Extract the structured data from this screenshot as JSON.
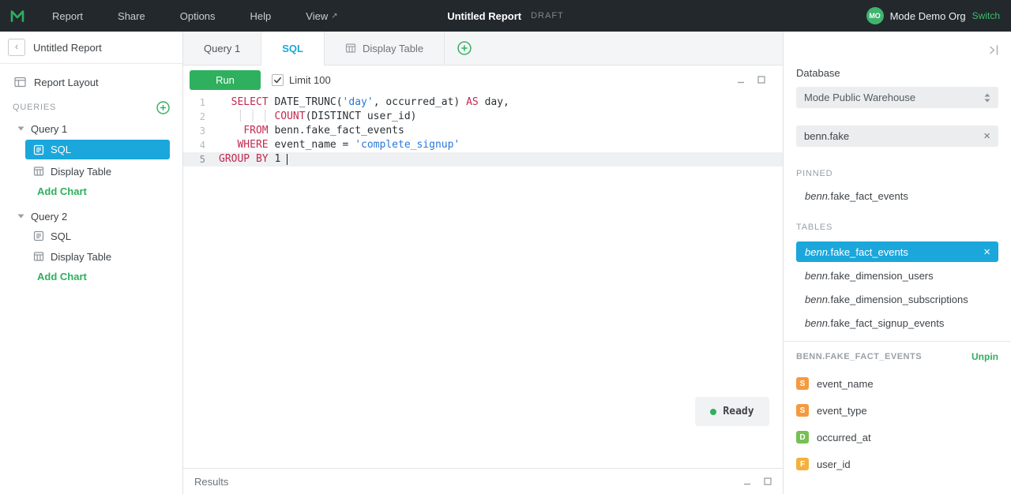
{
  "topbar": {
    "menu": [
      "Report",
      "Share",
      "Options",
      "Help",
      "View"
    ],
    "view_arrow": "↗",
    "title": "Untitled Report",
    "draft_badge": "DRAFT",
    "avatar_initials": "MO",
    "org_name": "Mode Demo Org",
    "switch_label": "Switch"
  },
  "icons": {
    "close_x": "×",
    "collapse_back": "‹"
  },
  "left_sidebar": {
    "report_title": "Untitled Report",
    "report_layout_label": "Report Layout",
    "queries_header": "QUERIES",
    "query1": {
      "name": "Query 1",
      "sql_label": "SQL",
      "display_table_label": "Display Table",
      "add_chart_label": "Add Chart"
    },
    "query2": {
      "name": "Query 2",
      "sql_label": "SQL",
      "display_table_label": "Display Table",
      "add_chart_label": "Add Chart"
    }
  },
  "tabs": {
    "query_tab": "Query 1",
    "sql_tab": "SQL",
    "display_table_tab": "Display Table"
  },
  "toolbar": {
    "run_label": "Run",
    "limit_label": "Limit 100",
    "limit_checked": true
  },
  "editor": {
    "lines": [
      {
        "num": "1",
        "tokens": [
          {
            "c": "plain",
            "t": "  "
          },
          {
            "c": "keyword",
            "t": "SELECT"
          },
          {
            "c": "plain",
            "t": " DATE_TRUNC("
          },
          {
            "c": "string",
            "t": "'day'"
          },
          {
            "c": "plain",
            "t": ", occurred_at) "
          },
          {
            "c": "keyword",
            "t": "AS"
          },
          {
            "c": "plain",
            "t": " day,"
          }
        ]
      },
      {
        "num": "2",
        "tokens": [
          {
            "c": "plain",
            "t": "   "
          },
          {
            "c": "indent-guide",
            "t": "│ │ │ "
          },
          {
            "c": "keyword",
            "t": "COUNT"
          },
          {
            "c": "plain",
            "t": "(DISTINCT user_id)"
          }
        ]
      },
      {
        "num": "3",
        "tokens": [
          {
            "c": "plain",
            "t": "    "
          },
          {
            "c": "keyword",
            "t": "FROM"
          },
          {
            "c": "plain",
            "t": " benn.fake_fact_events"
          }
        ]
      },
      {
        "num": "4",
        "tokens": [
          {
            "c": "plain",
            "t": "   "
          },
          {
            "c": "keyword",
            "t": "WHERE"
          },
          {
            "c": "plain",
            "t": " event_name = "
          },
          {
            "c": "string",
            "t": "'complete_signup'"
          }
        ]
      },
      {
        "num": "5",
        "tokens": [
          {
            "c": "keyword",
            "t": "GROUP BY"
          },
          {
            "c": "plain",
            "t": " 1 "
          }
        ]
      }
    ]
  },
  "status": {
    "ready_label": "Ready"
  },
  "results": {
    "header": "Results"
  },
  "right_sidebar": {
    "database_label": "Database",
    "database_value": "Mode Public Warehouse",
    "search_value": "benn.fake",
    "pinned_header": "PINNED",
    "pinned_item": {
      "schema": "benn.",
      "table": "fake_fact_events"
    },
    "tables_header": "TABLES",
    "selected_table": {
      "schema": "benn.",
      "table": "fake_fact_events"
    },
    "tables": [
      {
        "schema": "benn.",
        "table": "fake_dimension_users"
      },
      {
        "schema": "benn.",
        "table": "fake_dimension_subscriptions"
      },
      {
        "schema": "benn.",
        "table": "fake_fact_signup_events"
      }
    ],
    "columns_header": "BENN.FAKE_FACT_EVENTS",
    "unpin_label": "Unpin",
    "columns": [
      {
        "badge": "S",
        "name": "event_name"
      },
      {
        "badge": "S",
        "name": "event_type"
      },
      {
        "badge": "D",
        "name": "occurred_at"
      },
      {
        "badge": "F",
        "name": "user_id"
      }
    ]
  },
  "colors": {
    "brand_green": "#2eb05e",
    "accent_blue": "#1ba7dc",
    "keyword_red": "#c22a50",
    "string_blue": "#2878d8",
    "badge_string": "#f49a3f",
    "badge_datetime": "#77c053",
    "badge_float": "#f4b13f",
    "topbar_bg": "#23282d"
  }
}
